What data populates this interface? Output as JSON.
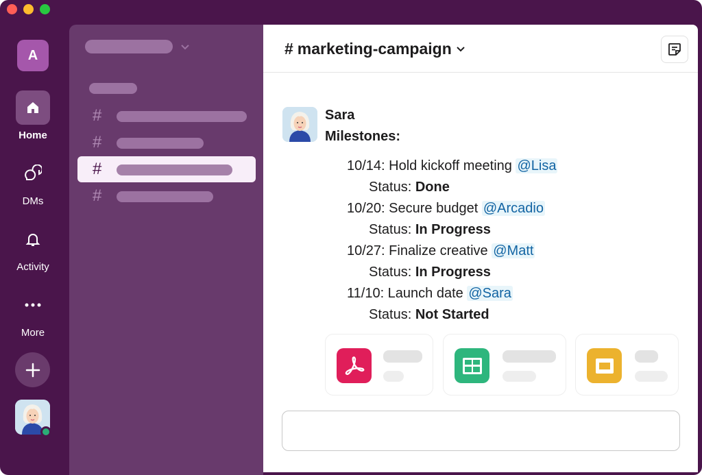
{
  "window": {
    "controls": [
      "close",
      "minimize",
      "maximize"
    ]
  },
  "rail": {
    "workspace_initial": "A",
    "items": [
      {
        "label": "Home",
        "icon": "home-icon",
        "active": true
      },
      {
        "label": "DMs",
        "icon": "dms-icon",
        "active": false
      },
      {
        "label": "Activity",
        "icon": "bell-icon",
        "active": false
      },
      {
        "label": "More",
        "icon": "more-icon",
        "active": false
      }
    ],
    "add_icon": "plus-icon",
    "presence": "active"
  },
  "sidebar": {
    "channel_prefix": "#",
    "channels_placeholder_count": 4,
    "selected_index": 2
  },
  "channel": {
    "hash": "#",
    "name": "marketing-campaign",
    "dropdown_icon": "chevron-down-icon",
    "canvas_icon": "canvas-icon"
  },
  "message": {
    "author": "Sara",
    "heading": "Milestones:",
    "status_label": "Status:",
    "milestones": [
      {
        "text": "10/14: Hold kickoff meeting",
        "mention": "@Lisa",
        "status": "Done"
      },
      {
        "text": "10/20: Secure budget",
        "mention": "@Arcadio",
        "status": "In Progress"
      },
      {
        "text": "10/27: Finalize creative",
        "mention": "@Matt",
        "status": "In Progress"
      },
      {
        "text": "11/10: Launch date",
        "mention": "@Sara",
        "status": "Not Started"
      }
    ],
    "attachments": [
      {
        "icon": "pdf-icon",
        "color": "#e01e5a"
      },
      {
        "icon": "spreadsheet-icon",
        "color": "#2eb67d"
      },
      {
        "icon": "slides-icon",
        "color": "#ecb22e"
      }
    ]
  },
  "colors": {
    "aubergine": "#4a154b",
    "sidebar": "#683a6c",
    "mention": "#1264a3"
  }
}
